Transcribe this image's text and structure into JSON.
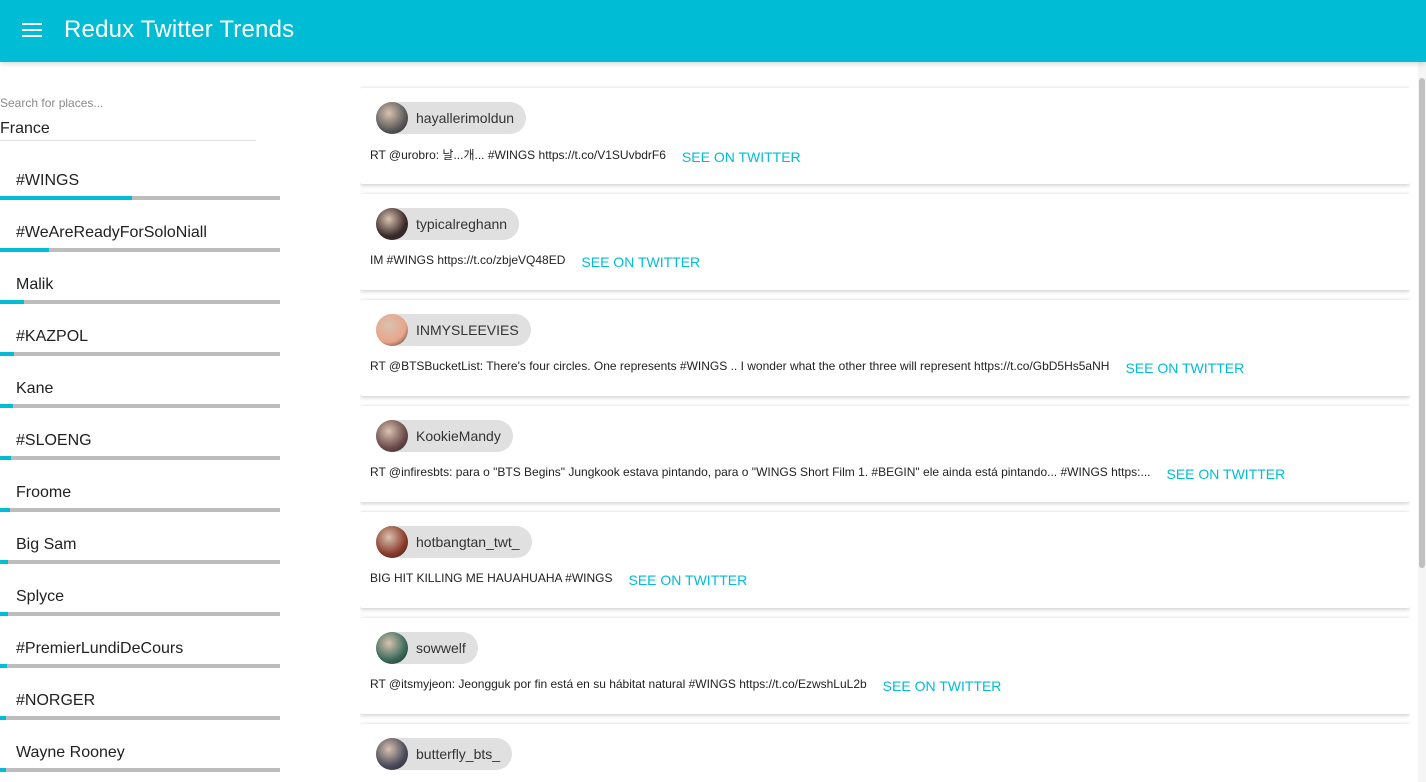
{
  "app": {
    "title": "Redux Twitter Trends"
  },
  "search": {
    "label": "Search for places...",
    "value": "France"
  },
  "trends": [
    {
      "label": "#WINGS",
      "level": 0.47
    },
    {
      "label": "#WeAreReadyForSoloNiall",
      "level": 0.175
    },
    {
      "label": "Malik",
      "level": 0.085
    },
    {
      "label": "#KAZPOL",
      "level": 0.05
    },
    {
      "label": "Kane",
      "level": 0.045
    },
    {
      "label": "#SLOENG",
      "level": 0.04
    },
    {
      "label": "Froome",
      "level": 0.035
    },
    {
      "label": "Big Sam",
      "level": 0.03
    },
    {
      "label": "Splyce",
      "level": 0.03
    },
    {
      "label": "#PremierLundiDeCours",
      "level": 0.025
    },
    {
      "label": "#NORGER",
      "level": 0.02
    },
    {
      "label": "Wayne Rooney",
      "level": 0.02
    }
  ],
  "tweets": [
    {
      "user": "hayallerimoldun",
      "text": "RT @urobro: 날...개... #WINGS https://t.co/V1SUvbdrF6",
      "link": "SEE ON TWITTER",
      "avatar_color": "#5a5a5a"
    },
    {
      "user": "typicalreghann",
      "text": "IM #WINGS https://t.co/zbjeVQ48ED",
      "link": "SEE ON TWITTER",
      "avatar_color": "#3a2a2a"
    },
    {
      "user": "INMYSLEEVIES",
      "text": "RT @BTSBucketList: There's four circles. One represents #WINGS .. I wonder what the other three will represent https://t.co/GbD5Hs5aNH",
      "link": "SEE ON TWITTER",
      "avatar_color": "#e8a48a"
    },
    {
      "user": "KookieMandy",
      "text": "RT @infiresbts: para o \"BTS Begins\" Jungkook estava pintando, para o \"WINGS Short Film 1. #BEGIN\" ele ainda está pintando... #WINGS https:...",
      "link": "SEE ON TWITTER",
      "avatar_color": "#6b4a4a"
    },
    {
      "user": "hotbangtan_twt_",
      "text": "BIG HIT KILLING ME HAUAHUAHA #WINGS",
      "link": "SEE ON TWITTER",
      "avatar_color": "#8a3a2a"
    },
    {
      "user": "sowwelf",
      "text": "RT @itsmyjeon: Jeongguk por fin está en su hábitat natural #WINGS https://t.co/EzwshLuL2b",
      "link": "SEE ON TWITTER",
      "avatar_color": "#3a6a5a"
    },
    {
      "user": "butterfly_bts_",
      "text": "",
      "link": "",
      "avatar_color": "#4a4a5a"
    }
  ]
}
